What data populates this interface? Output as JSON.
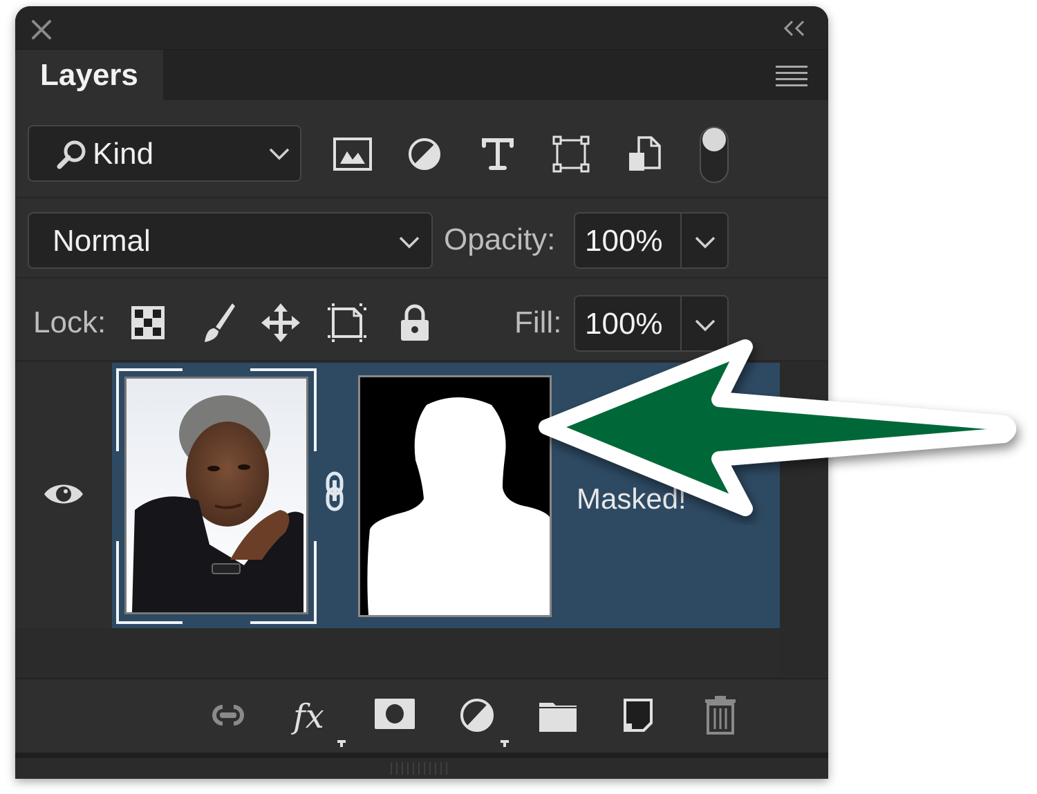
{
  "panel": {
    "tab_label": "Layers",
    "close_icon": "close-icon",
    "collapse_icon": "double-chevron-left-icon",
    "menu_icon": "panel-menu-icon"
  },
  "filter": {
    "kind_label": "Kind",
    "icons": [
      "pixel-layer-filter-icon",
      "adjustment-layer-filter-icon",
      "type-layer-filter-icon",
      "shape-layer-filter-icon",
      "smart-object-filter-icon"
    ],
    "toggle_on": true
  },
  "blending": {
    "mode": "Normal",
    "opacity_label": "Opacity:",
    "opacity_value": "100%"
  },
  "lock": {
    "label": "Lock:",
    "icons": [
      "lock-transparent-pixels-icon",
      "lock-image-pixels-icon",
      "lock-position-icon",
      "lock-artboard-icon",
      "lock-all-icon"
    ],
    "fill_label": "Fill:",
    "fill_value": "100%"
  },
  "layers": [
    {
      "name": "Masked!",
      "visible": true,
      "selected": true,
      "has_mask": true,
      "mask_linked": true
    }
  ],
  "footer": {
    "icons": [
      "link-layers-icon",
      "fx-icon",
      "add-mask-icon",
      "adjustment-layer-icon",
      "new-group-icon",
      "new-layer-icon",
      "delete-icon"
    ]
  },
  "annotation": {
    "arrow_color": "#006837",
    "arrow_outline": "#ffffff"
  },
  "colors": {
    "panel_bg": "#2f2f2f",
    "selection": "#2e4a63",
    "text": "#f0f0f0"
  }
}
